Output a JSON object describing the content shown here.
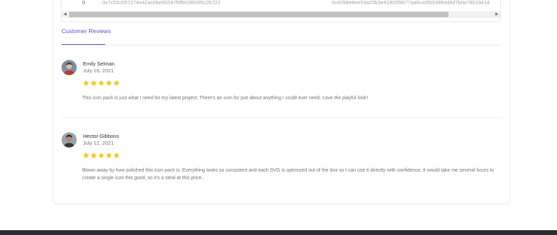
{
  "transactions": {
    "row": {
      "index": "0",
      "hash1": "0x7c52c057274e42ac0be90297f8fb03653f0c2b722",
      "hash2": "0x4058e8ee53a20b3e41905f9677aa6ca5fb5396ed4d7b0a78018414"
    },
    "scroll_left_glyph": "◀",
    "scroll_right_glyph": "▶"
  },
  "tabs": {
    "active_label": "Customer Reviews",
    "accent_color": "#5b4fcf"
  },
  "reviews": [
    {
      "name": "Emily Selman",
      "date": "July 16, 2021",
      "rating": 5,
      "rating_max": 5,
      "text": "This icon pack is just what I need for my latest project. There's an icon for just about anything I could ever need. Love the playful look!"
    },
    {
      "name": "Hector Gibbons",
      "date": "July 12, 2021",
      "rating": 5,
      "rating_max": 5,
      "text": "Blown away by how polished this icon pack is. Everything looks so consistent and each SVG is optimized out of the box so I can use it directly with confidence. It would take me several hours to create a single icon this good, so it's a steal at this price."
    }
  ],
  "colors": {
    "star": "#f5c518",
    "footer": "#2b2d33"
  }
}
